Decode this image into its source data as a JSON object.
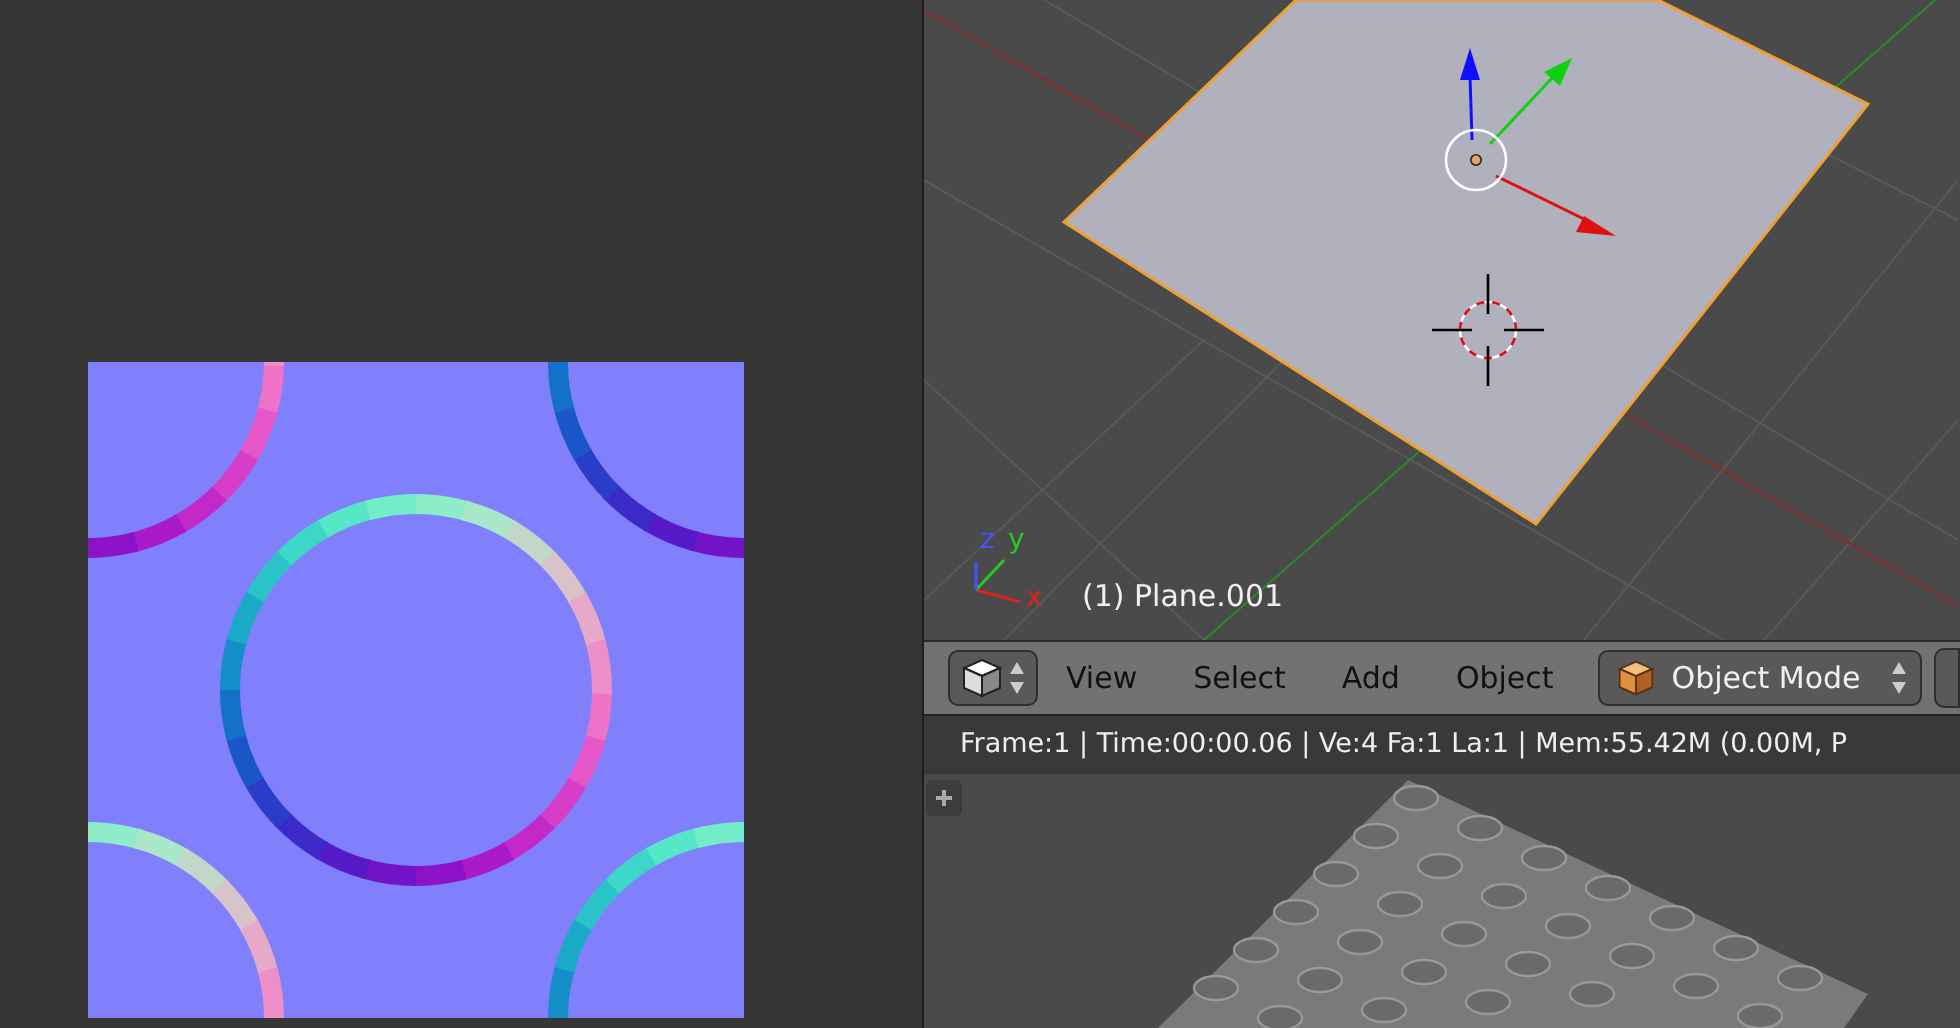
{
  "viewport": {
    "object_label": "(1) Plane.001",
    "axes": [
      {
        "label": "x",
        "color": "#dd2222"
      },
      {
        "label": "y",
        "color": "#22cc22"
      },
      {
        "label": "z",
        "color": "#4455ff"
      }
    ]
  },
  "header": {
    "menus": [
      "View",
      "Select",
      "Add",
      "Object"
    ],
    "mode": "Object Mode"
  },
  "status_bar": "Frame:1 | Time:00:00.06 | Ve:4 Fa:1 La:1 | Mem:55.42M (0.00M, P"
}
